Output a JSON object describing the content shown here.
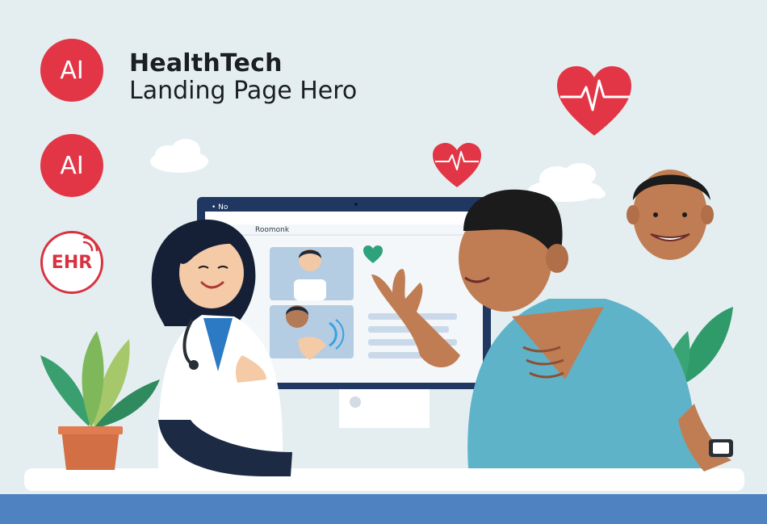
{
  "hero": {
    "title_line1": "HealthTech",
    "title_line2": "Landing Page Hero"
  },
  "badges": [
    {
      "label": "AI"
    },
    {
      "label": "AI"
    },
    {
      "label": "EHR"
    }
  ],
  "monitor": {
    "top_label": "• No",
    "app_label": "Roomonk"
  },
  "colors": {
    "background": "#e4eef0",
    "accent_red": "#e23646",
    "floor_blue": "#4f82c1",
    "monitor_navy": "#1f3761",
    "shirt_teal": "#5fb3c9"
  },
  "icons": [
    "heart-pulse-icon",
    "heart-pulse-icon",
    "green-heart-icon",
    "cloud",
    "plant",
    "smartwatch"
  ]
}
